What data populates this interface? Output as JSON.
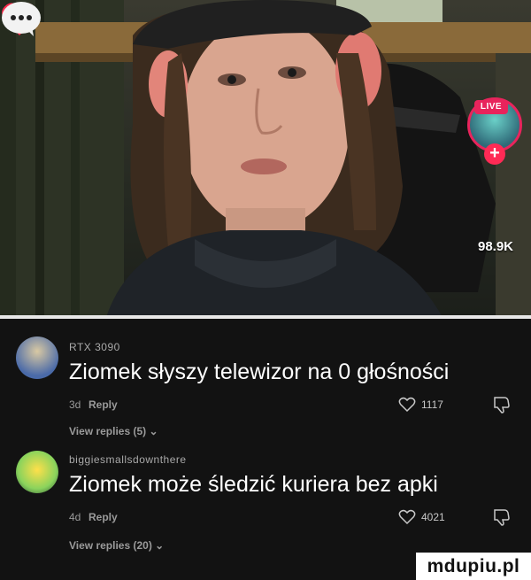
{
  "video": {
    "live_label": "LIVE",
    "follow_label": "+",
    "like_count": "98.9K",
    "comment_icon": "speech-bubble-dots-icon"
  },
  "comments": [
    {
      "username": "RTX 3090",
      "text": "Ziomek słyszy telewizor na 0 głośności",
      "time": "3d",
      "reply_label": "Reply",
      "likes": "1117",
      "view_replies": "View replies (5)"
    },
    {
      "username": "biggiesmallsdownthere",
      "text": "Ziomek może śledzić kuriera bez apki",
      "time": "4d",
      "reply_label": "Reply",
      "likes": "4021",
      "view_replies": "View replies (20)"
    }
  ],
  "watermark": "mdupiu.pl",
  "colors": {
    "accent_pink": "#e8245c",
    "background": "#121212"
  }
}
